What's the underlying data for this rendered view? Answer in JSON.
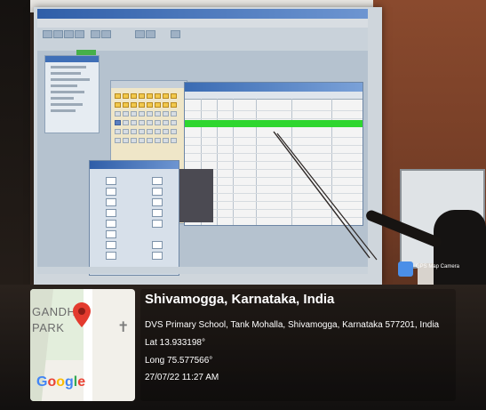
{
  "map": {
    "label_left": "GANDH",
    "label_left2": "PARK",
    "logo": "Google"
  },
  "location": {
    "title": "Shivamogga, Karnataka, India",
    "address": "DVS Primary School, Tank Mohalla, Shivamogga, Karnataka 577201, India",
    "lat": "Lat 13.933198°",
    "long": "Long 75.577566°",
    "timestamp": "27/07/22 11:27 AM"
  },
  "badge": {
    "label": "GPS Map Camera",
    "icon": "gps-map-camera-icon"
  },
  "colors": {
    "highlight": "#2fd62f",
    "pin": "#e33b2e"
  }
}
